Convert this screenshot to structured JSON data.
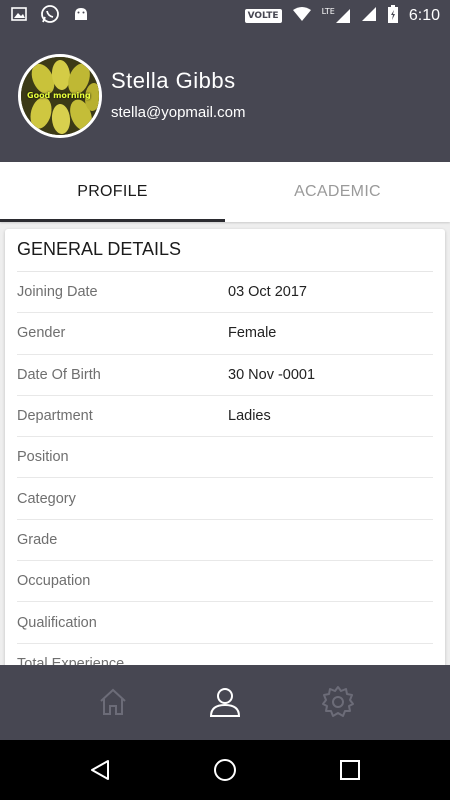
{
  "status_bar": {
    "left_icons": [
      "image-icon",
      "whatsapp-icon",
      "android-icon"
    ],
    "volte": "VOLTE",
    "network": "LTE",
    "time": "6:10"
  },
  "profile": {
    "name": "Stella  Gibbs",
    "email": "stella@yopmail.com",
    "avatar_text": "Good morning"
  },
  "tabs": [
    {
      "label": "PROFILE",
      "active": true
    },
    {
      "label": "ACADEMIC",
      "active": false
    }
  ],
  "general": {
    "title": "GENERAL DETAILS",
    "rows": [
      {
        "label": "Joining Date",
        "value": "03 Oct 2017"
      },
      {
        "label": "Gender",
        "value": "Female"
      },
      {
        "label": "Date Of Birth",
        "value": "30 Nov -0001"
      },
      {
        "label": "Department",
        "value": "Ladies"
      },
      {
        "label": "Position",
        "value": ""
      },
      {
        "label": "Category",
        "value": ""
      },
      {
        "label": "Grade",
        "value": ""
      },
      {
        "label": "Occupation",
        "value": ""
      },
      {
        "label": "Qualification",
        "value": ""
      },
      {
        "label": "Total Experience",
        "value": ""
      }
    ]
  },
  "bottom_nav": {
    "items": [
      "home-icon",
      "person-icon",
      "settings-icon"
    ],
    "active": "person-icon"
  },
  "colors": {
    "header": "#474752",
    "accent": "#2b2b30",
    "inactive_tab": "#9a9a9a"
  }
}
